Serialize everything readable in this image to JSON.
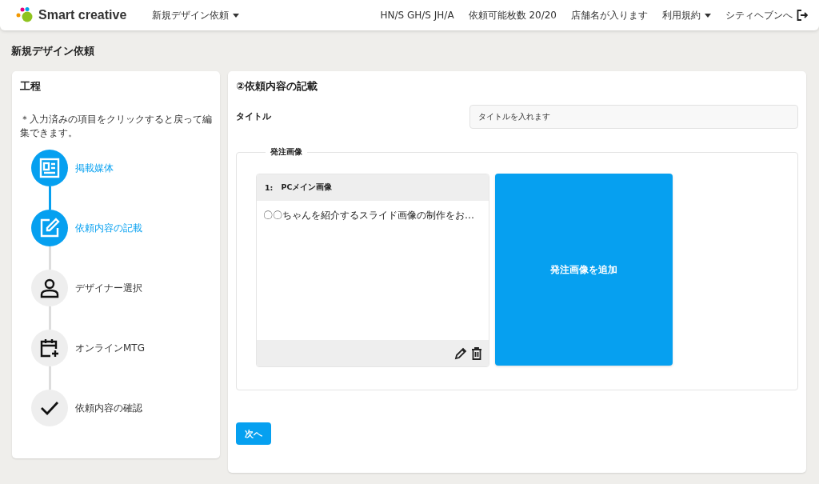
{
  "header": {
    "logo": "Smart creative",
    "menu": {
      "label": "新規デザイン依頼"
    },
    "items": [
      {
        "kind": "text",
        "label": "HN/S GH/S JH/A"
      },
      {
        "kind": "text",
        "label": "依頼可能枚数 20/20"
      },
      {
        "kind": "text",
        "label": "店舗名が入ります"
      },
      {
        "kind": "dropdown",
        "label": "利用規約"
      },
      {
        "kind": "logout",
        "label": "シティヘブンへ"
      }
    ]
  },
  "page_title": "新規デザイン依頼",
  "steps_panel": {
    "title": "工程",
    "note": "＊入力済みの項目をクリックすると戻って編集できます。",
    "steps": [
      {
        "kind": "media",
        "label": "掲載媒体",
        "completed": true
      },
      {
        "kind": "edit",
        "label": "依頼内容の記載",
        "completed": true
      },
      {
        "kind": "person",
        "label": "デザイナー選択",
        "completed": false
      },
      {
        "kind": "calendar",
        "label": "オンラインMTG",
        "completed": false
      },
      {
        "kind": "check",
        "label": "依頼内容の確認",
        "completed": false
      }
    ]
  },
  "form": {
    "title": "②依頼内容の記載",
    "title_field": {
      "label": "タイトル",
      "value": "タイトルを入れます"
    },
    "images": {
      "legend": "発注画像",
      "cards": [
        {
          "number": "1:",
          "name": "PCメイン画像",
          "description": "〇〇ちゃんを紹介するスライド画像の制作をお…"
        }
      ],
      "add_button": "発注画像を追加"
    },
    "next_button": "次へ"
  }
}
